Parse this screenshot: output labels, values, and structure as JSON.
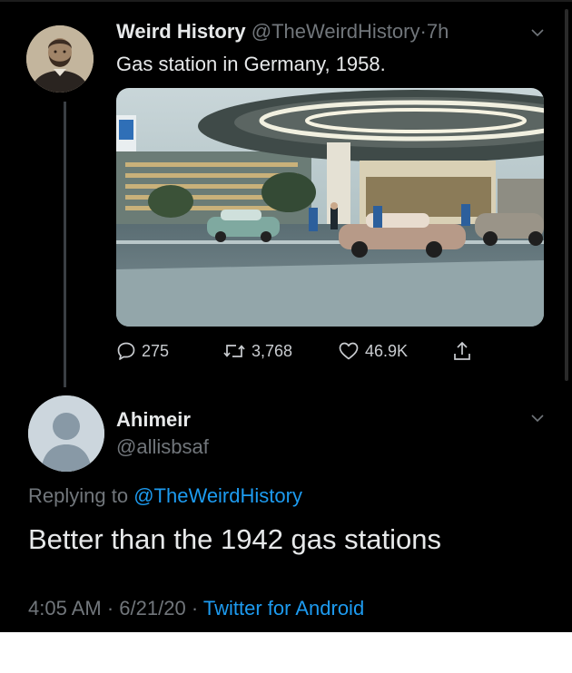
{
  "tweet": {
    "display_name": "Weird History",
    "handle": "@TheWeirdHistory",
    "separator": "·",
    "time": "7h",
    "text": "Gas station in Germany, 1958.",
    "actions": {
      "replies": "275",
      "retweets": "3,768",
      "likes": "46.9K"
    },
    "icons": {
      "reply": "speech-bubble-icon",
      "retweet": "retweet-arrows-icon",
      "like": "heart-icon",
      "share": "share-upload-icon",
      "menu": "chevron-down-icon"
    }
  },
  "reply": {
    "display_name": "Ahimeir",
    "handle": "@allisbsaf",
    "replying_prefix": "Replying to",
    "replying_to": "@TheWeirdHistory",
    "text": "Better than the 1942 gas stations",
    "time": "4:05 AM",
    "separator": "·",
    "date": "6/21/20",
    "separator2": "·",
    "source": "Twitter for Android"
  },
  "colors": {
    "background": "#000000",
    "text": "#e7e9ea",
    "muted": "#71767b",
    "link": "#1d9bf0"
  }
}
